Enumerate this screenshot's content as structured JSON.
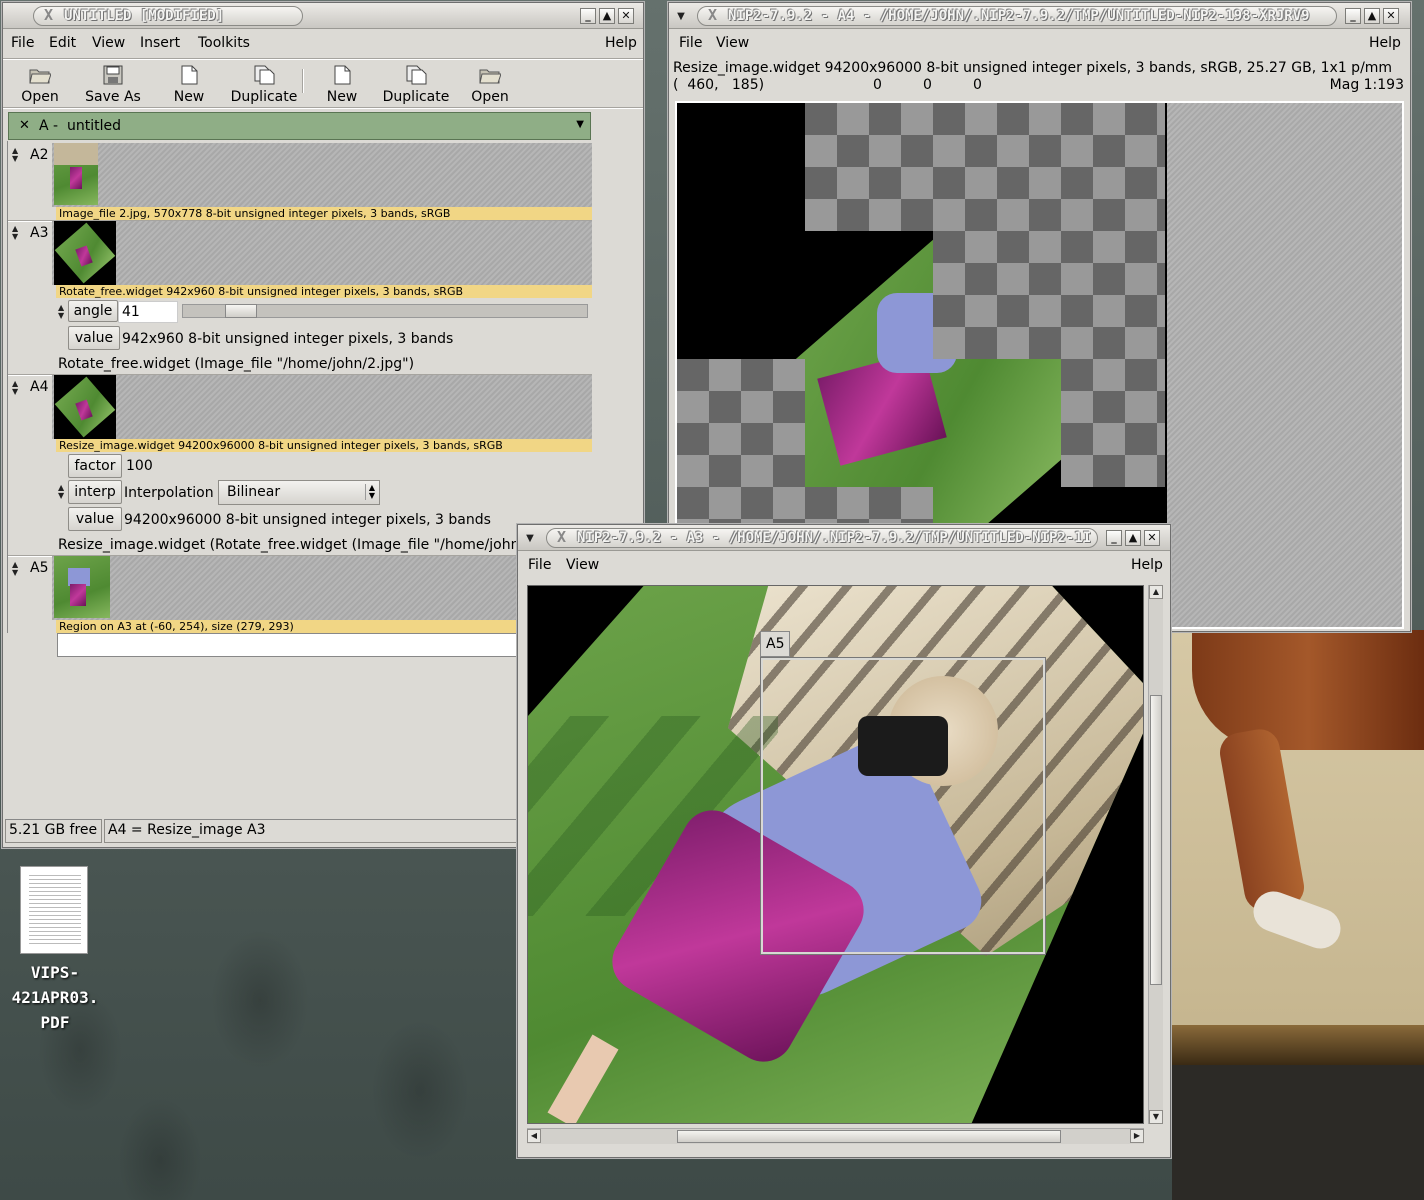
{
  "main_window": {
    "title": "UNTITLED [MODIFIED]",
    "menu": [
      "File",
      "Edit",
      "View",
      "Insert",
      "Toolkits"
    ],
    "help": "Help",
    "toolbar": [
      "Open",
      "Save As",
      "New",
      "Duplicate",
      "New",
      "Duplicate",
      "Open"
    ],
    "workspace_tab": "A -  untitled",
    "rows": {
      "a2": {
        "label": "A2",
        "caption": "Image_file 2.jpg, 570x778 8-bit unsigned integer pixels, 3 bands, sRGB"
      },
      "a3": {
        "label": "A3",
        "caption": "Rotate_free.widget 942x960 8-bit unsigned integer pixels, 3 bands, sRGB",
        "angle_label": "angle",
        "angle_value": "41",
        "value_label": "value",
        "value_text": "942x960 8-bit unsigned integer pixels, 3 bands",
        "formula": "Rotate_free.widget (Image_file \"/home/john/2.jpg\")"
      },
      "a4": {
        "label": "A4",
        "caption": "Resize_image.widget 94200x96000 8-bit unsigned integer pixels, 3 bands, sRGB",
        "factor_label": "factor",
        "factor_value": "100",
        "interp_label": "interp",
        "interp_text": "Interpolation",
        "interp_select": "Bilinear",
        "value_label": "value",
        "value_text": "94200x96000 8-bit unsigned integer pixels, 3 bands",
        "formula": "Resize_image.widget (Rotate_free.widget (Image_file \"/home/john"
      },
      "a5": {
        "label": "A5",
        "caption": "Region on A3 at (-60, 254), size (279, 293)"
      }
    },
    "status_free": "5.21 GB free",
    "status_msg": "A4 = Resize_image A3"
  },
  "viewer_a4": {
    "title": "NIP2-7.9.2 - A4 - /HOME/JOHN/.NIP2-7.9.2/TMP/UNTITLED-NIP2-198-XRJRV9",
    "menu": [
      "File",
      "View"
    ],
    "help": "Help",
    "info": "Resize_image.widget 94200x96000 8-bit unsigned integer pixels, 3 bands, sRGB, 25.27 GB, 1x1 p/mm",
    "coords": "(  460,   185)",
    "pixel": [
      "0",
      "0",
      "0"
    ],
    "mag": "Mag 1:193"
  },
  "viewer_a3": {
    "title": "NIP2-7.9.2 - A3 - /HOME/JOHN/.NIP2-7.9.2/TMP/UNTITLED-NIP2-1I",
    "menu": [
      "File",
      "View"
    ],
    "help": "Help",
    "region_label": "A5"
  },
  "desktop_icon": {
    "label": "VIPS-421APR03.PDF",
    "line1": "VIPS-",
    "line2": "421APR03.",
    "line3": "PDF"
  }
}
